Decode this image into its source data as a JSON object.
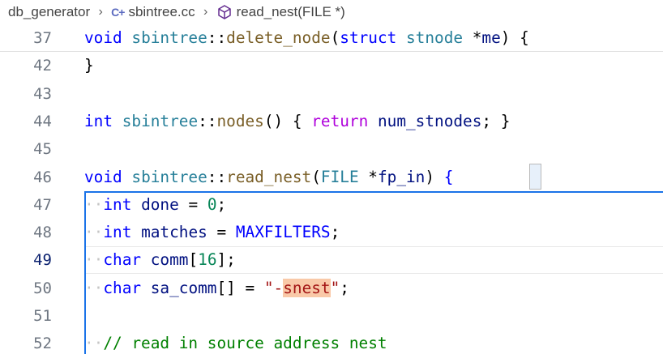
{
  "breadcrumb": {
    "folder": "db_generator",
    "file": "sbintree.cc",
    "symbol": "read_nest(FILE *)"
  },
  "lines": [
    {
      "num": "37",
      "tokens": [
        [
          "void",
          "kw"
        ],
        [
          " ",
          ""
        ],
        [
          "sbintree",
          "ty"
        ],
        [
          "::",
          ""
        ],
        [
          "delete_node",
          "fn"
        ],
        [
          "(",
          ""
        ],
        [
          "struct",
          "kw"
        ],
        [
          " ",
          ""
        ],
        [
          "stnode",
          "ty"
        ],
        [
          " *",
          ""
        ],
        [
          "me",
          "var"
        ],
        [
          ") {",
          ""
        ]
      ]
    },
    {
      "num": "42",
      "tokens": [
        [
          "}",
          ""
        ]
      ]
    },
    {
      "num": "43",
      "tokens": []
    },
    {
      "num": "44",
      "tokens": [
        [
          "int",
          "kw"
        ],
        [
          " ",
          ""
        ],
        [
          "sbintree",
          "ty"
        ],
        [
          "::",
          ""
        ],
        [
          "nodes",
          "fn"
        ],
        [
          "() { ",
          ""
        ],
        [
          "return",
          "ctl"
        ],
        [
          " ",
          ""
        ],
        [
          "num_stnodes",
          "var"
        ],
        [
          "; }",
          ""
        ]
      ]
    },
    {
      "num": "45",
      "tokens": []
    },
    {
      "num": "46",
      "tokens": [
        [
          "void",
          "kw"
        ],
        [
          " ",
          ""
        ],
        [
          "sbintree",
          "ty"
        ],
        [
          "::",
          ""
        ],
        [
          "read_nest",
          "fn"
        ],
        [
          "(",
          ""
        ],
        [
          "FILE",
          "ty"
        ],
        [
          " *",
          ""
        ],
        [
          "fp_in",
          "var"
        ],
        [
          ") ",
          ""
        ],
        [
          "{",
          "brace"
        ]
      ]
    },
    {
      "num": "47",
      "tokens": [
        [
          "··",
          "dots"
        ],
        [
          "int",
          "kw"
        ],
        [
          " ",
          ""
        ],
        [
          "done",
          "var"
        ],
        [
          " = ",
          ""
        ],
        [
          "0",
          "num"
        ],
        [
          ";",
          ""
        ]
      ]
    },
    {
      "num": "48",
      "tokens": [
        [
          "··",
          "dots"
        ],
        [
          "int",
          "kw"
        ],
        [
          " ",
          ""
        ],
        [
          "matches",
          "var"
        ],
        [
          " = ",
          ""
        ],
        [
          "MAXFILTERS",
          "mac"
        ],
        [
          ";",
          ""
        ]
      ]
    },
    {
      "num": "49",
      "tokens": [
        [
          "··",
          "dots"
        ],
        [
          "char",
          "kw"
        ],
        [
          " ",
          ""
        ],
        [
          "comm",
          "var"
        ],
        [
          "[",
          ""
        ],
        [
          "16",
          "num"
        ],
        [
          "];",
          ""
        ]
      ]
    },
    {
      "num": "50",
      "tokens": [
        [
          "··",
          "dots"
        ],
        [
          "char",
          "kw"
        ],
        [
          " ",
          ""
        ],
        [
          "sa_comm",
          "var"
        ],
        [
          "[] = ",
          ""
        ],
        [
          "\"-",
          "str"
        ],
        [
          "snest",
          "strsel"
        ],
        [
          "\"",
          "str"
        ],
        [
          ";",
          ""
        ]
      ]
    },
    {
      "num": "51",
      "tokens": []
    },
    {
      "num": "52",
      "tokens": [
        [
          "··",
          "dots"
        ],
        [
          "// read in source address nest",
          "cm"
        ]
      ]
    }
  ],
  "active_line": "49",
  "colors": {
    "keyword": "#0000ff",
    "control": "#af00db",
    "function": "#795e26",
    "type": "#267f99",
    "variable": "#001080",
    "number": "#098658",
    "string": "#a31515",
    "comment": "#008000",
    "selection": "#f9c9a8",
    "scope_outline": "#1a73e8"
  },
  "icons": [
    "chevron-right-icon",
    "cpp-file-icon",
    "method-cube-icon"
  ]
}
